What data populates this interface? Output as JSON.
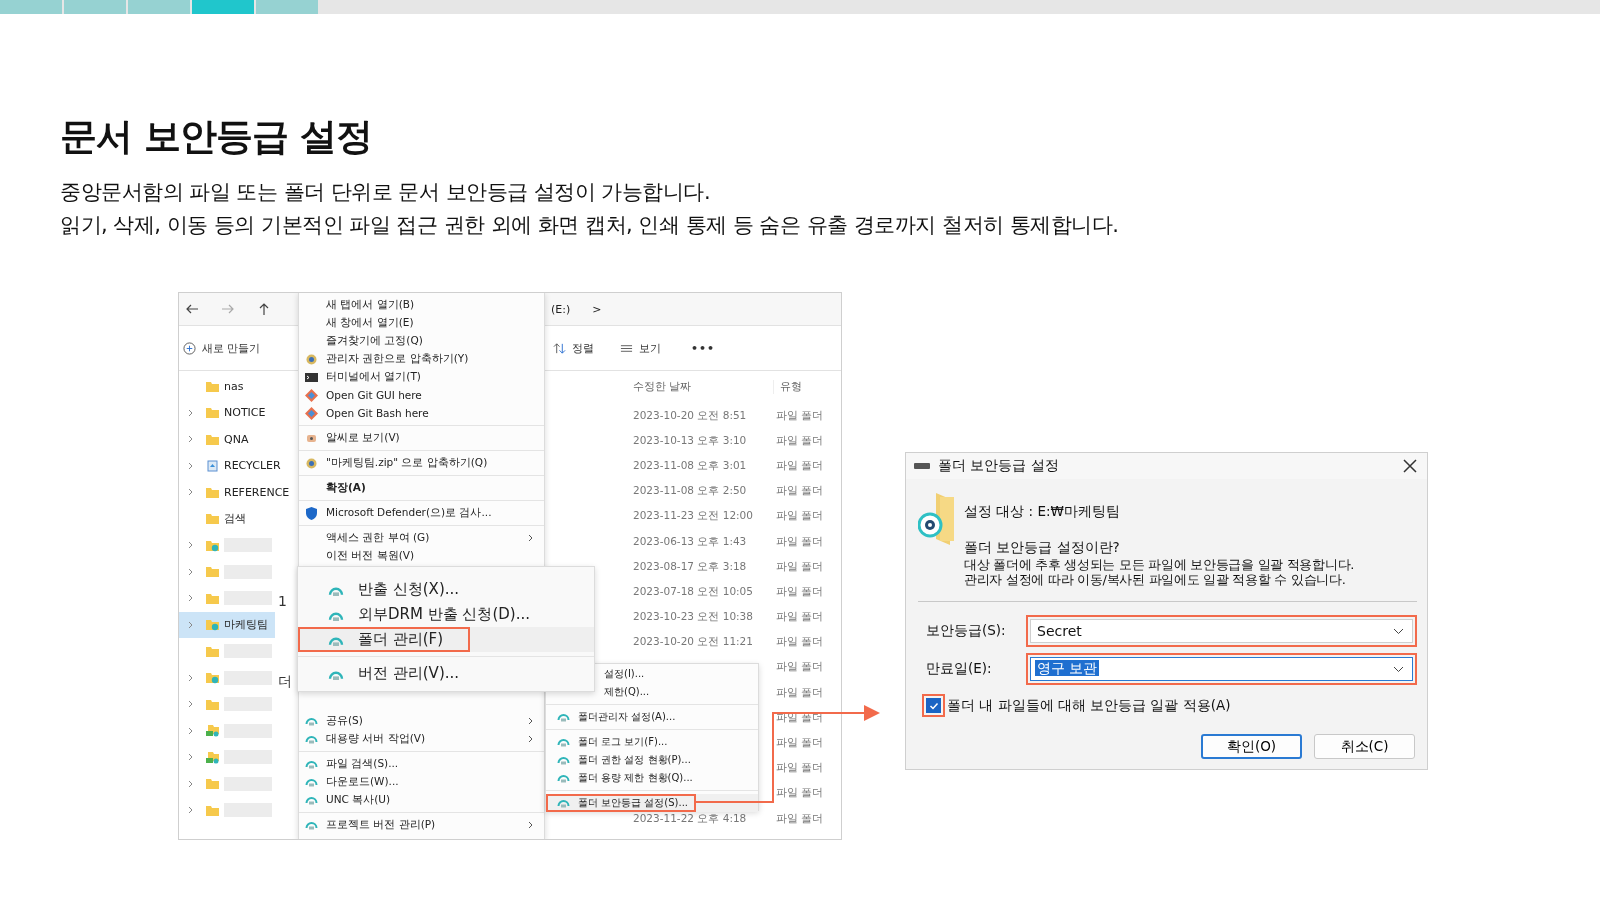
{
  "progress_steps": [
    {
      "selected": false
    },
    {
      "selected": false
    },
    {
      "selected": false
    },
    {
      "selected": true
    },
    {
      "selected": false
    }
  ],
  "heading": "문서 보안등급 설정",
  "description": [
    "중앙문서함의 파일 또는 폴더 단위로 문서 보안등급 설정이 가능합니다.",
    "읽기, 삭제, 이동 등의 기본적인 파일 접근 권한 외에 화면 캡처, 인쇄 통제 등 숨은 유출 경로까지 철저히 통제합니다."
  ],
  "explorer": {
    "address": "(E:)",
    "address_chevron": ">",
    "new_button": "새로 만들기",
    "sort_button": "정렬",
    "view_button": "보기",
    "more_button": "•••",
    "nav_items": [
      {
        "label": "nas",
        "kind": "folder",
        "expandable": false,
        "selected": false
      },
      {
        "label": "NOTICE",
        "kind": "folder",
        "expandable": true,
        "selected": false
      },
      {
        "label": "QNA",
        "kind": "folder",
        "expandable": true,
        "selected": false
      },
      {
        "label": "RECYCLER",
        "kind": "recycler",
        "expandable": true,
        "selected": false
      },
      {
        "label": "REFERENCE",
        "kind": "folder",
        "expandable": true,
        "selected": false
      },
      {
        "label": "검색",
        "kind": "folder",
        "expandable": false,
        "selected": false
      },
      {
        "redacted": true,
        "kind": "shared",
        "expandable": true,
        "selected": false
      },
      {
        "redacted": true,
        "kind": "folder",
        "expandable": true,
        "selected": false
      },
      {
        "redacted": true,
        "kind": "folder",
        "expandable": true,
        "selected": false
      },
      {
        "label": "마케팅팀",
        "kind": "shared",
        "expandable": true,
        "selected": true
      },
      {
        "redacted": true,
        "kind": "folder",
        "expandable": false,
        "selected": false
      },
      {
        "redacted": true,
        "kind": "shared",
        "expandable": true,
        "selected": false
      },
      {
        "redacted": true,
        "kind": "folder",
        "expandable": true,
        "selected": false
      },
      {
        "redacted": true,
        "kind": "network",
        "expandable": true,
        "selected": false
      },
      {
        "redacted": true,
        "kind": "network",
        "expandable": true,
        "selected": false
      },
      {
        "redacted": true,
        "kind": "folder",
        "expandable": true,
        "selected": false
      },
      {
        "redacted": true,
        "kind": "folder",
        "expandable": true,
        "selected": false
      }
    ],
    "fragments": [
      "1",
      "더"
    ],
    "columns": [
      "수정한 날짜",
      "유형"
    ],
    "rows": [
      {
        "date": "2023-10-20 오전 8:51",
        "type": "파일 폴더"
      },
      {
        "date": "2023-10-13 오후 3:10",
        "type": "파일 폴더"
      },
      {
        "date": "2023-11-08 오후 3:01",
        "type": "파일 폴더"
      },
      {
        "date": "2023-11-08 오후 2:50",
        "type": "파일 폴더"
      },
      {
        "date": "2023-11-23 오전 12:00",
        "type": "파일 폴더"
      },
      {
        "date": "2023-06-13 오후 1:43",
        "type": "파일 폴더"
      },
      {
        "date": "2023-08-17 오후 3:18",
        "type": "파일 폴더"
      },
      {
        "date": "2023-07-18 오전 10:05",
        "type": "파일 폴더"
      },
      {
        "date": "2023-10-23 오전 10:38",
        "type": "파일 폴더"
      },
      {
        "date": "2023-10-20 오전 11:21",
        "type": "파일 폴더"
      },
      {
        "type": "파일 폴더"
      },
      {
        "type": "파일 폴더"
      },
      {
        "type": "파일 폴더"
      },
      {
        "type": "파일 폴더"
      },
      {
        "type": "파일 폴더"
      },
      {
        "type": "파일 폴더"
      },
      {
        "date": "2023-11-22 오후 4:18",
        "type": "파일 폴더"
      }
    ]
  },
  "context_menu": {
    "items": [
      {
        "kind": "item",
        "label": "새 탭에서 열기(B)",
        "submenu": false
      },
      {
        "kind": "item",
        "label": "새 창에서 열기(E)",
        "submenu": false
      },
      {
        "kind": "item",
        "label": "즐겨찾기에 고정(Q)",
        "submenu": false
      },
      {
        "kind": "item",
        "label": "관리자 권한으로 압축하기(Y)",
        "submenu": false
      },
      {
        "kind": "item",
        "label": "터미널에서 열기(T)",
        "submenu": false
      },
      {
        "kind": "item",
        "label": "Open Git GUI here",
        "submenu": false
      },
      {
        "kind": "item",
        "label": "Open Git Bash here",
        "submenu": false
      },
      {
        "kind": "separator"
      },
      {
        "kind": "item",
        "label": "알씨로 보기(V)",
        "submenu": false
      },
      {
        "kind": "separator"
      },
      {
        "kind": "item",
        "label": "\"마케팅팀.zip\" 으로 압축하기(Q)",
        "submenu": false
      },
      {
        "kind": "separator"
      },
      {
        "kind": "bold",
        "label": "확장(A)",
        "submenu": false
      },
      {
        "kind": "separator"
      },
      {
        "kind": "item",
        "label": "Microsoft Defender(으)로 검사...",
        "submenu": false
      },
      {
        "kind": "separator"
      },
      {
        "kind": "item",
        "label": "액세스 권한 부여 (G)",
        "submenu": true
      },
      {
        "kind": "item",
        "label": "이전 버전 복원(V)",
        "submenu": false
      },
      {
        "kind": "covered"
      },
      {
        "kind": "item",
        "label": "공유(S)",
        "submenu": true
      },
      {
        "kind": "item",
        "label": "대용량 서버 작업(V)",
        "submenu": true
      },
      {
        "kind": "separator"
      },
      {
        "kind": "item",
        "label": "파일 검색(S)...",
        "submenu": false
      },
      {
        "kind": "item",
        "label": "다운로드(W)...",
        "submenu": false
      },
      {
        "kind": "item",
        "label": "UNC 복사(U)",
        "submenu": false
      },
      {
        "kind": "separator"
      },
      {
        "kind": "item",
        "label": "프로젝트 버전 관리(P)",
        "submenu": true
      }
    ]
  },
  "magnified_menu": {
    "items": [
      {
        "kind": "item",
        "label": "반출 신청(X)...",
        "highlighted": false
      },
      {
        "kind": "item",
        "label": "외부DRM 반출 신청(D)...",
        "highlighted": false
      },
      {
        "kind": "item",
        "label": "폴더 관리(F)",
        "highlighted": true
      },
      {
        "kind": "separator"
      },
      {
        "kind": "item",
        "label": "버전 관리(V)...",
        "highlighted": false
      }
    ]
  },
  "folder_submenu": {
    "items": [
      {
        "kind": "partial",
        "label": "설정(I)...",
        "highlighted": false
      },
      {
        "kind": "partial",
        "label": "제한(Q)...",
        "highlighted": false
      },
      {
        "kind": "separator"
      },
      {
        "kind": "item",
        "label": "폴더관리자 설정(A)...",
        "highlighted": false
      },
      {
        "kind": "separator"
      },
      {
        "kind": "item",
        "label": "폴더 로그 보기(F)...",
        "highlighted": false
      },
      {
        "kind": "item",
        "label": "폴더 권한 설정 현황(P)...",
        "highlighted": false
      },
      {
        "kind": "item",
        "label": "폴더 용량 제한 현황(Q)...",
        "highlighted": false
      },
      {
        "kind": "separator"
      },
      {
        "kind": "item",
        "label": "폴더 보안등급 설정(S)...",
        "highlighted": true
      }
    ]
  },
  "dialog": {
    "title": "폴더 보안등급 설정",
    "target": "설정 대상 : E:₩마케팅팀",
    "question": "폴더 보안등급 설정이란?",
    "explanation": [
      "대상 폴더에 추후 생성되는 모든 파일에 보안등급을 일괄 적용합니다.",
      "관리자 설정에 따라 이동/복사된 파일에도 일괄 적용할 수 있습니다."
    ],
    "fields": [
      {
        "label": "보안등급(S):",
        "value": "Secret",
        "text_selected": false,
        "highlighted": true
      },
      {
        "label": "만료일(E):",
        "value": "영구 보관",
        "text_selected": true,
        "highlighted": true
      }
    ],
    "apply_checkbox": {
      "label": "폴더 내 파일들에 대해 보안등급 일괄 적용(A)",
      "checked": true,
      "highlighted": true
    },
    "buttons": [
      {
        "label": "확인(O)",
        "default": true
      },
      {
        "label": "취소(C)",
        "default": false
      }
    ]
  }
}
